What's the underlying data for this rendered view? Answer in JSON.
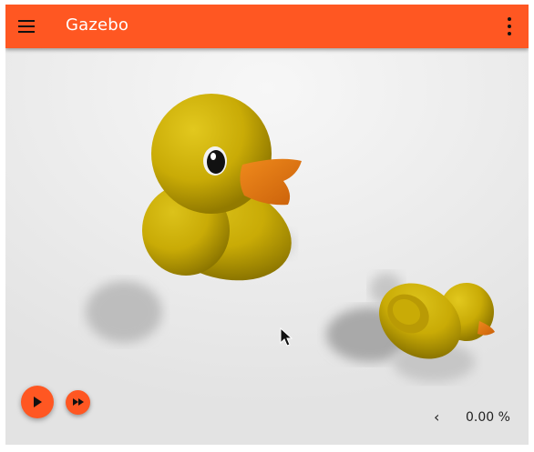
{
  "toolbar": {
    "title": "Gazebo",
    "menu_icon": "hamburger-menu-icon",
    "more_icon": "more-vert-icon",
    "color": "#ff5722"
  },
  "controls": {
    "play_icon": "play-icon",
    "step_icon": "fast-forward-icon",
    "rtf_chevron": "‹",
    "real_time_factor": "0.00 %"
  },
  "scene": {
    "objects": [
      "rubber-duck",
      "rubber-duck"
    ]
  }
}
